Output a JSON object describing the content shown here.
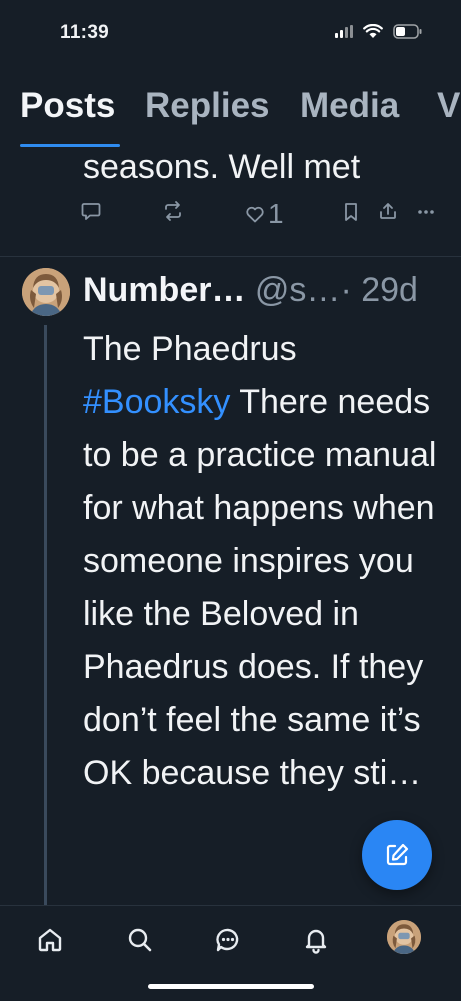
{
  "status": {
    "time": "11:39"
  },
  "tabs": [
    {
      "label": "Posts",
      "active": true
    },
    {
      "label": "Replies",
      "active": false
    },
    {
      "label": "Media",
      "active": false
    },
    {
      "label": "V",
      "active": false
    }
  ],
  "previous_post": {
    "text": "seasons.  Well met",
    "like_count": "1"
  },
  "post": {
    "author_name": "Number…",
    "author_handle": "@s…",
    "separator": "·",
    "age": "29d",
    "text_before": "The Phaedrus ",
    "hashtag": "#Booksky",
    "text_after": " There needs to be a practice manual for what happens when someone inspires you like the Beloved in Phaedrus does. If they don’t feel the same it’s OK because they sti…"
  },
  "icons": {
    "reply": "speech-bubble-icon",
    "repost": "repost-arrows-icon",
    "like": "heart-icon",
    "bookmark": "bookmark-icon",
    "share": "share-icon",
    "more": "ellipsis-icon",
    "compose": "pencil-square-icon",
    "nav_home": "home-icon",
    "nav_search": "search-icon",
    "nav_messages": "chat-bubble-icon",
    "nav_notifications": "bell-icon",
    "nav_profile": "avatar"
  },
  "colors": {
    "background": "#161e27",
    "accent": "#2f8cf0",
    "hashtag": "#3390ff",
    "muted": "#8a97a5"
  }
}
